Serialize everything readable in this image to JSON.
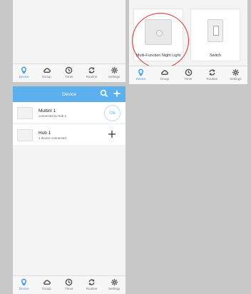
{
  "nav": {
    "items": [
      {
        "label": "Device",
        "icon": "bulb-icon"
      },
      {
        "label": "Group",
        "icon": "cloud-icon"
      },
      {
        "label": "Timer",
        "icon": "clock-icon"
      },
      {
        "label": "Routine",
        "icon": "cycle-icon"
      },
      {
        "label": "Settings",
        "icon": "gear-icon"
      }
    ],
    "active": "Device",
    "active_color": "#3d9cf0"
  },
  "tiles": [
    {
      "label": "Multi-Function Night Light"
    },
    {
      "label": "Switch"
    }
  ],
  "device_panel": {
    "title": "Device",
    "header_color": "#5cb0ee",
    "devices": [
      {
        "name": "Multinl 1",
        "sub": "connected to Hub 1",
        "action": "ON"
      },
      {
        "name": "Hub 1",
        "sub": "1 device connected",
        "action": "+"
      }
    ]
  },
  "annotation_color": "#e0302a"
}
